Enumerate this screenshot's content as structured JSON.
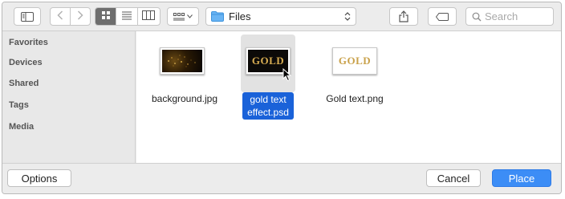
{
  "toolbar": {
    "location_label": "Files",
    "search_placeholder": "Search"
  },
  "sidebar": {
    "items": [
      {
        "label": "Favorites"
      },
      {
        "label": "Devices"
      },
      {
        "label": "Shared"
      },
      {
        "label": "Tags"
      },
      {
        "label": "Media"
      }
    ]
  },
  "files": [
    {
      "name": "background.jpg",
      "selected": false
    },
    {
      "name_line1": "gold text",
      "name_line2": "effect.psd",
      "selected": true
    },
    {
      "name": "Gold text.png",
      "selected": false
    }
  ],
  "thumbnails": {
    "gold_text": "GOLD"
  },
  "footer": {
    "options_label": "Options",
    "cancel_label": "Cancel",
    "place_label": "Place"
  },
  "colors": {
    "accent": "#3c8df6",
    "selection": "#1a62d9",
    "gold": "#c9a14a"
  }
}
